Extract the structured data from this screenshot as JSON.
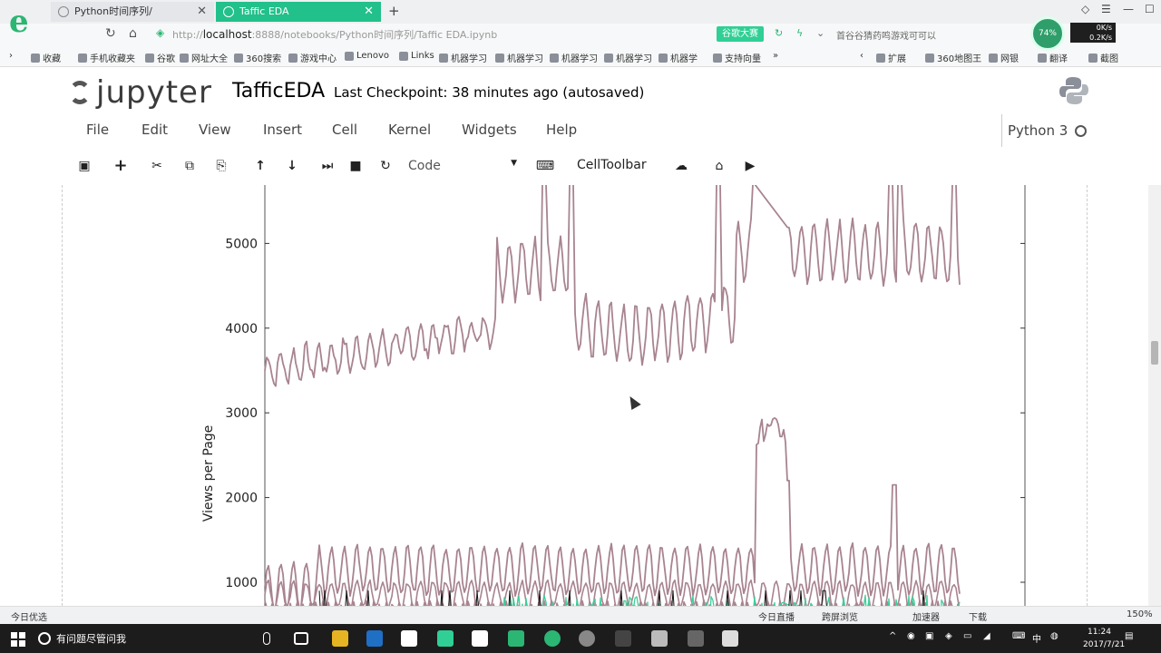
{
  "browser": {
    "tabs": [
      {
        "label": "Python时间序列/"
      },
      {
        "label": "Taffic EDA"
      }
    ],
    "close_glyph": "✕",
    "new_tab_glyph": "+",
    "url": {
      "scheme": "http://",
      "host": "localhost",
      "path": ":8888/notebooks/Python时间序列/Taffic EDA.ipynb"
    },
    "speed_button": "谷歌大赛",
    "search_hint": "首谷谷猜药鸣游戏可可以",
    "net_circle": "74%",
    "net_up": "0K/s",
    "net_down": "0.2K/s",
    "bookmarks": [
      "收藏",
      "手机收藏夹",
      "谷歌",
      "网址大全",
      "360搜索",
      "游戏中心",
      "Lenovo",
      "Links",
      "机器学习",
      "机器学习",
      "机器学习",
      "机器学习",
      "机器学",
      "支持向量"
    ],
    "bookmarks_right": [
      "扩展",
      "360地图王",
      "网银",
      "翻译",
      "截图"
    ],
    "status": {
      "left": "今日优选",
      "right": [
        "今日直播",
        "跨屏浏览",
        "加速器",
        "下载"
      ],
      "zoom": "150%"
    }
  },
  "jupyter": {
    "logo_text": "jupyter",
    "notebook_name": "TafficEDA",
    "checkpoint": "Last Checkpoint: 38 minutes ago (autosaved)",
    "menu": [
      "File",
      "Edit",
      "View",
      "Insert",
      "Cell",
      "Kernel",
      "Widgets",
      "Help"
    ],
    "kernel": "Python 3",
    "cell_type": "Code",
    "celltoolbar": "CellToolbar"
  },
  "chart_data": {
    "type": "line",
    "title": "",
    "xlabel": "",
    "ylabel": "Views per Page",
    "ylim": [
      -250,
      5700
    ],
    "yticks": [
      1000,
      2000,
      3000,
      4000,
      5000
    ],
    "grid": false,
    "x": "day index 0–550 (visible portion)",
    "series": [
      {
        "color": "#a8848f",
        "values_summary": "rises from ~3500 to ~4000 (day 0–250), jumps to ~4800 with spikes to 5700 (day 260–330), dips to ~3900 (day 330–520), gap, then ~4700–5600 (day 540–750)"
      },
      {
        "color": "#a8848f",
        "values_summary": "~1000 baseline with peaks 1300–1800, spike to 2950 around day 540–580, 2150 spike near day 690"
      },
      {
        "color": "#a8848f",
        "values_summary": "~700–1000 oscillating"
      },
      {
        "color": "#a8848f",
        "values_summary": "~500–800 oscillating"
      },
      {
        "color": "#3ecf9a",
        "values_summary": "~200–800 noisy, visible from day 250"
      },
      {
        "color": "#111111",
        "values_summary": "~100–900 sparse spikes"
      }
    ]
  },
  "taskbar": {
    "search_text": "有问题尽管问我",
    "clock_time": "11:24",
    "clock_date": "2017/7/21",
    "ime": "中"
  }
}
